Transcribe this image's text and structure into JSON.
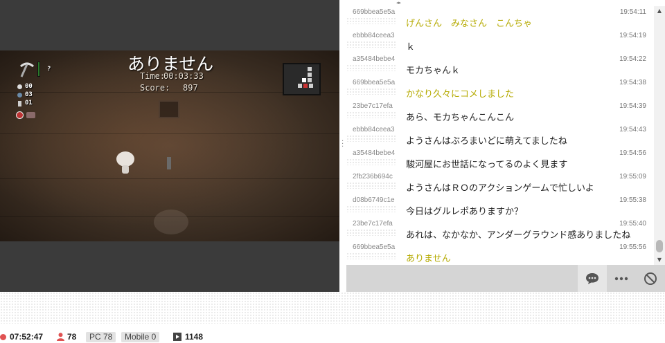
{
  "video": {
    "overlay_message": "ありません",
    "time_label": "Time:",
    "time_value": "00:03:33",
    "score_label": "Score:",
    "score_value": "897",
    "hud_unknown": "?",
    "coins": "00",
    "bombs": "03",
    "keys": "01"
  },
  "chat": {
    "messages": [
      {
        "user": "669bbea5e5a",
        "time": "19:54:11",
        "text": "げんさん　みなさん　こんちゃ",
        "owner": true
      },
      {
        "user": "ebbb84ceea3",
        "time": "19:54:19",
        "text": "ｋ",
        "owner": false
      },
      {
        "user": "a35484bebe4",
        "time": "19:54:22",
        "text": "モカちゃんｋ",
        "owner": false
      },
      {
        "user": "669bbea5e5a",
        "time": "19:54:38",
        "text": "かなり久々にコメしました",
        "owner": true
      },
      {
        "user": "23be7c17efa",
        "time": "19:54:39",
        "text": "あら、モカちゃんこんこん",
        "owner": false
      },
      {
        "user": "ebbb84ceea3",
        "time": "19:54:43",
        "text": "ようさんはぶろまいどに萌えてましたね",
        "owner": false
      },
      {
        "user": "a35484bebe4",
        "time": "19:54:56",
        "text": "駿河屋にお世話になってるのよく見ます",
        "owner": false
      },
      {
        "user": "2fb236b694c",
        "time": "19:55:09",
        "text": "ようさんはＲＯのアクションゲームで忙しいよ",
        "owner": false
      },
      {
        "user": "d08b6749c1e",
        "time": "19:55:38",
        "text": "今日はグルレポありますか？",
        "owner": false
      },
      {
        "user": "23be7c17efa",
        "time": "19:55:40",
        "text": "あれは、なかなか、アンダーグラウンド感ありましたね",
        "owner": false
      },
      {
        "user": "669bbea5e5a",
        "time": "19:55:56",
        "text": "ありません",
        "owner": true
      }
    ],
    "owner_color": "#b5aa00"
  },
  "toolbar": {
    "icons": [
      "comment-icon",
      "more-icon",
      "block-icon"
    ]
  },
  "stats": {
    "elapsed": "07:52:47",
    "viewers": "78",
    "pc_label": "PC 78",
    "mobile_label": "Mobile 0",
    "comments": "1148",
    "live_color": "#e05252",
    "viewer_icon_color": "#e05252"
  }
}
